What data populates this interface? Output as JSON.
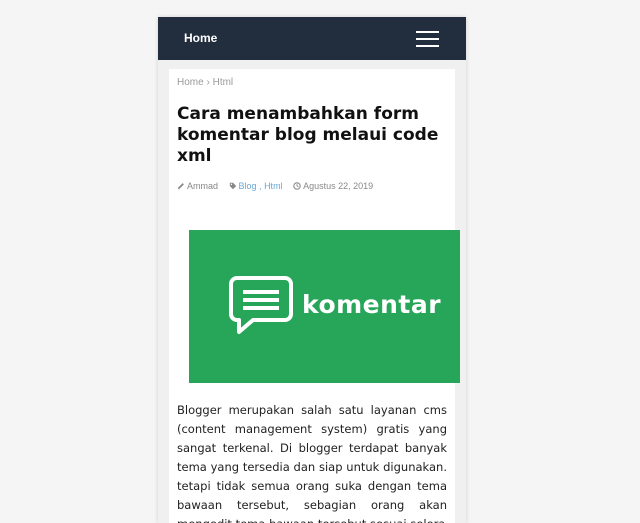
{
  "navbar": {
    "home_label": "Home"
  },
  "breadcrumb": {
    "home": "Home",
    "separator": "›",
    "category": "Html"
  },
  "post": {
    "title": "Cara menambahkan form komentar blog melaui code xml",
    "author": "Ammad",
    "labels": [
      "Blog",
      "Html"
    ],
    "label_separator": " , ",
    "date": "Agustus 22, 2019",
    "hero_text": "komentar",
    "body": "Blogger merupakan salah satu layanan cms (content management system) gratis yang sangat terkenal. Di blogger terdapat banyak tema yang tersedia dan siap untuk digunakan. tetapi tidak semua orang suka dengan tema bawaan tersebut, sebagian orang akan mengedit tema bawaan tersebut sesuai selera"
  },
  "colors": {
    "navbar_bg": "#222d3e",
    "hero_bg": "#27a65a",
    "link": "#6aa8d8"
  },
  "icons": {
    "menu": "hamburger-menu-icon",
    "author": "pencil-icon",
    "labels": "tag-icon",
    "date": "clock-icon",
    "hero": "chat-bubble-icon"
  }
}
